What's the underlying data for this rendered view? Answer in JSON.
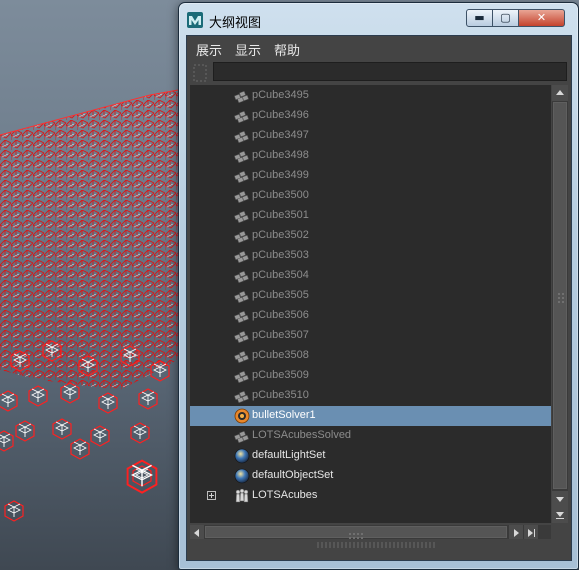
{
  "window": {
    "title": "大纲视图",
    "controls": {
      "minimize": "▬",
      "maximize": "▢",
      "close": "✕"
    },
    "app_icon": "maya-logo-icon"
  },
  "menu": [
    "展示",
    "显示",
    "帮助"
  ],
  "outliner": {
    "items": [
      {
        "label": "pCube3495",
        "icon": "transform-icon",
        "dim": true
      },
      {
        "label": "pCube3496",
        "icon": "transform-icon",
        "dim": true
      },
      {
        "label": "pCube3497",
        "icon": "transform-icon",
        "dim": true
      },
      {
        "label": "pCube3498",
        "icon": "transform-icon",
        "dim": true
      },
      {
        "label": "pCube3499",
        "icon": "transform-icon",
        "dim": true
      },
      {
        "label": "pCube3500",
        "icon": "transform-icon",
        "dim": true
      },
      {
        "label": "pCube3501",
        "icon": "transform-icon",
        "dim": true
      },
      {
        "label": "pCube3502",
        "icon": "transform-icon",
        "dim": true
      },
      {
        "label": "pCube3503",
        "icon": "transform-icon",
        "dim": true
      },
      {
        "label": "pCube3504",
        "icon": "transform-icon",
        "dim": true
      },
      {
        "label": "pCube3505",
        "icon": "transform-icon",
        "dim": true
      },
      {
        "label": "pCube3506",
        "icon": "transform-icon",
        "dim": true
      },
      {
        "label": "pCube3507",
        "icon": "transform-icon",
        "dim": true
      },
      {
        "label": "pCube3508",
        "icon": "transform-icon",
        "dim": true
      },
      {
        "label": "pCube3509",
        "icon": "transform-icon",
        "dim": true
      },
      {
        "label": "pCube3510",
        "icon": "transform-icon",
        "dim": true
      },
      {
        "label": "bulletSolver1",
        "icon": "bullet-solver-icon",
        "selected": true
      },
      {
        "label": "LOTSAcubesSolved",
        "icon": "transform-icon",
        "dim": true
      },
      {
        "label": "defaultLightSet",
        "icon": "set-icon"
      },
      {
        "label": "defaultObjectSet",
        "icon": "set-icon"
      },
      {
        "label": "LOTSAcubes",
        "icon": "group-icon",
        "expandable": true
      }
    ]
  },
  "colors": {
    "selection": "#6a8fb2",
    "wire": "#e01010",
    "panel": "#444444"
  }
}
